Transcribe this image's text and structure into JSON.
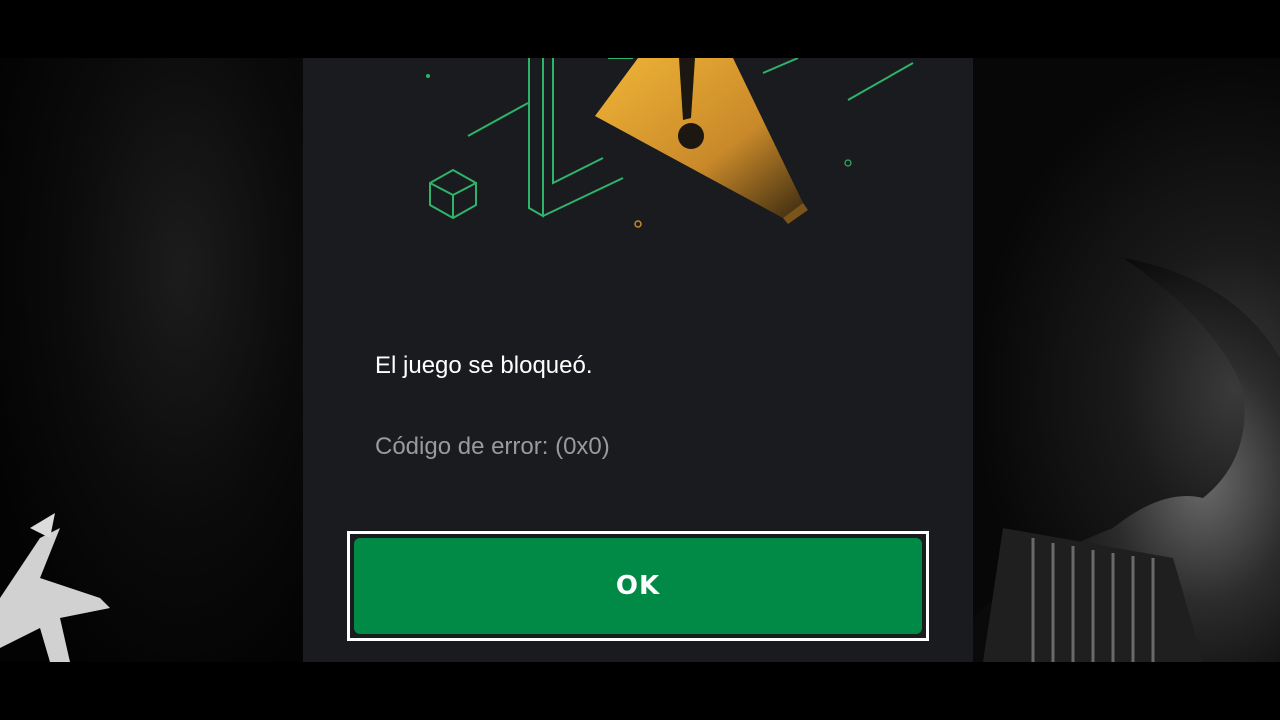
{
  "dialog": {
    "title": "El juego se bloqueó.",
    "error_code": "Código de error: (0x0)",
    "ok_label": "OK"
  },
  "illustration": {
    "icon": "warning-triangle-icon",
    "accent_color": "#e2a42a",
    "line_color": "#2fb36a"
  },
  "colors": {
    "dialog_bg": "#1a1b1f",
    "button_bg": "#008a46",
    "title_text": "#ffffff",
    "secondary_text": "#9a9a9d"
  }
}
